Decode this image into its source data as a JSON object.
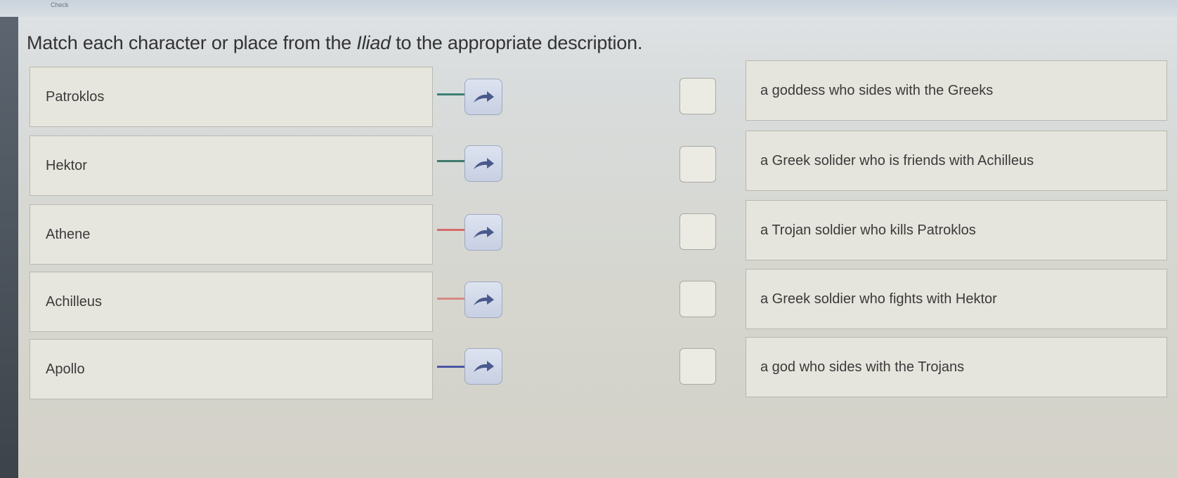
{
  "header": {
    "check_label": "Check"
  },
  "prompt": {
    "before": "Match each character or place from the ",
    "title": "Iliad",
    "after": " to the appropriate description."
  },
  "terms": [
    {
      "label": "Patroklos",
      "connector_color": "#3e7f76"
    },
    {
      "label": "Hektor",
      "connector_color": "#3f7a6b"
    },
    {
      "label": "Athene",
      "connector_color": "#d76a6a"
    },
    {
      "label": "Achilleus",
      "connector_color": "#d98a86"
    },
    {
      "label": "Apollo",
      "connector_color": "#4a56a6"
    }
  ],
  "descriptions": [
    {
      "label": "a goddess who sides with the Greeks"
    },
    {
      "label": "a Greek solider who is friends with Achilleus"
    },
    {
      "label": "a Trojan soldier who kills Patroklos"
    },
    {
      "label": "a Greek soldier who fights with Hektor"
    },
    {
      "label": "a god who sides with the Trojans"
    }
  ],
  "colors": {
    "arrow": "#4a5a8c",
    "arrow_button_bg": "#d3d9e8"
  },
  "icons": {
    "arrow": "curved-arrow-right-icon"
  }
}
